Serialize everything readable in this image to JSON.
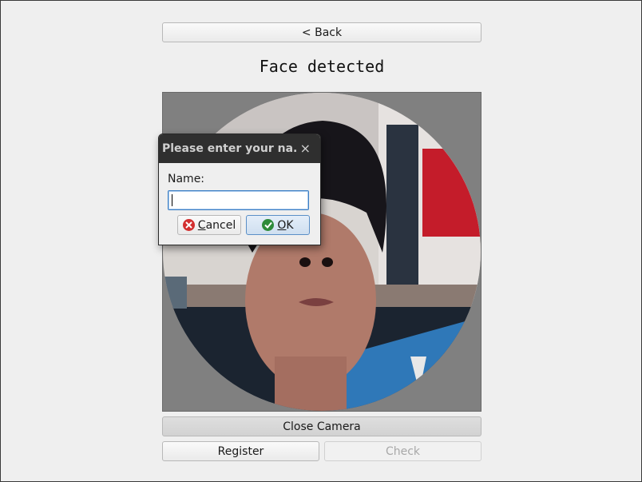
{
  "back_label": "< Back",
  "status_title": "Face detected",
  "close_camera_label": "Close Camera",
  "register_label": "Register",
  "check_label": "Check",
  "dialog": {
    "title": "Please enter your na...",
    "close_glyph": "×",
    "name_label": "Name:",
    "name_value": "",
    "cancel_mnemonic": "C",
    "cancel_rest": "ancel",
    "ok_mnemonic": "O",
    "ok_rest": "K"
  },
  "colors": {
    "cancel_icon": "#d32f2f",
    "ok_icon": "#2e8b3a",
    "camera_bg": "#808080"
  }
}
